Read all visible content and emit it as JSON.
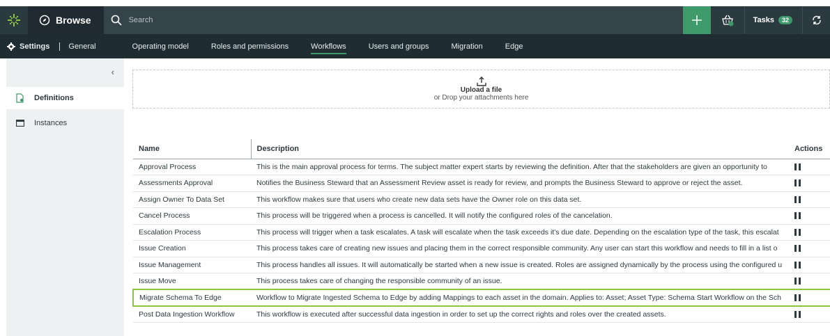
{
  "topbar": {
    "browse_label": "Browse",
    "search_placeholder": "Search",
    "basket_count": "1",
    "tasks_label": "Tasks",
    "tasks_count": "32"
  },
  "settings": {
    "label": "Settings",
    "tabs": [
      {
        "label": "General"
      },
      {
        "label": "Operating model"
      },
      {
        "label": "Roles and permissions"
      },
      {
        "label": "Workflows"
      },
      {
        "label": "Users and groups"
      },
      {
        "label": "Migration"
      },
      {
        "label": "Edge"
      }
    ],
    "active_tab": "Workflows"
  },
  "sidebar": {
    "collapse_glyph": "‹",
    "items": [
      {
        "label": "Definitions",
        "active": true
      },
      {
        "label": "Instances",
        "active": false
      }
    ]
  },
  "upload": {
    "title": "Upload a file",
    "subtitle": "or Drop your attachments here"
  },
  "table": {
    "headers": {
      "name": "Name",
      "description": "Description",
      "actions": "Actions"
    },
    "rows": [
      {
        "name": "Approval Process",
        "description": "This is the main approval process for terms. The subject matter expert starts by reviewing the definition. After that the stakeholders are given an opportunity to"
      },
      {
        "name": "Assessments Approval",
        "description": "Notifies the Business Steward that an Assessment Review asset is ready for review, and prompts the Business Steward to approve or reject the asset."
      },
      {
        "name": "Assign Owner To Data Set",
        "description": "This workflow makes sure that users who create new data sets have the Owner role on this data set."
      },
      {
        "name": "Cancel Process",
        "description": "This process will be triggered when a process is cancelled. It will notify the configured roles of the cancelation."
      },
      {
        "name": "Escalation Process",
        "description": "This process will trigger when a task escalates. A task will escalate when the task exceeds it's due date. Depending on the escalation type of the task, this escalat"
      },
      {
        "name": "Issue Creation",
        "description": "This process takes care of creating new issues and placing them in the correct responsible community. Any user can start this workflow and needs to fill in a list o"
      },
      {
        "name": "Issue Management",
        "description": "This process handles all issues. It will automatically be started when a new issue is created. Roles are assigned dynamically by the process using the configured u"
      },
      {
        "name": "Issue Move",
        "description": "This process takes care of changing the responsible community of an issue."
      },
      {
        "name": "Migrate Schema To Edge",
        "description": "Workflow to Migrate Ingested Schema to Edge by adding Mappings to each asset in the domain. Applies to: Asset; Asset Type: Schema Start Workflow on the Sch",
        "highlighted": true
      },
      {
        "name": "Post Data Ingestion Workflow",
        "description": "This workflow is executed after successful data ingestion in order to set up the correct rights and roles over the created assets."
      }
    ]
  },
  "colors": {
    "accent": "#3e9a6b",
    "highlight": "#8cc63f",
    "topbar": "#2b3a3f"
  }
}
